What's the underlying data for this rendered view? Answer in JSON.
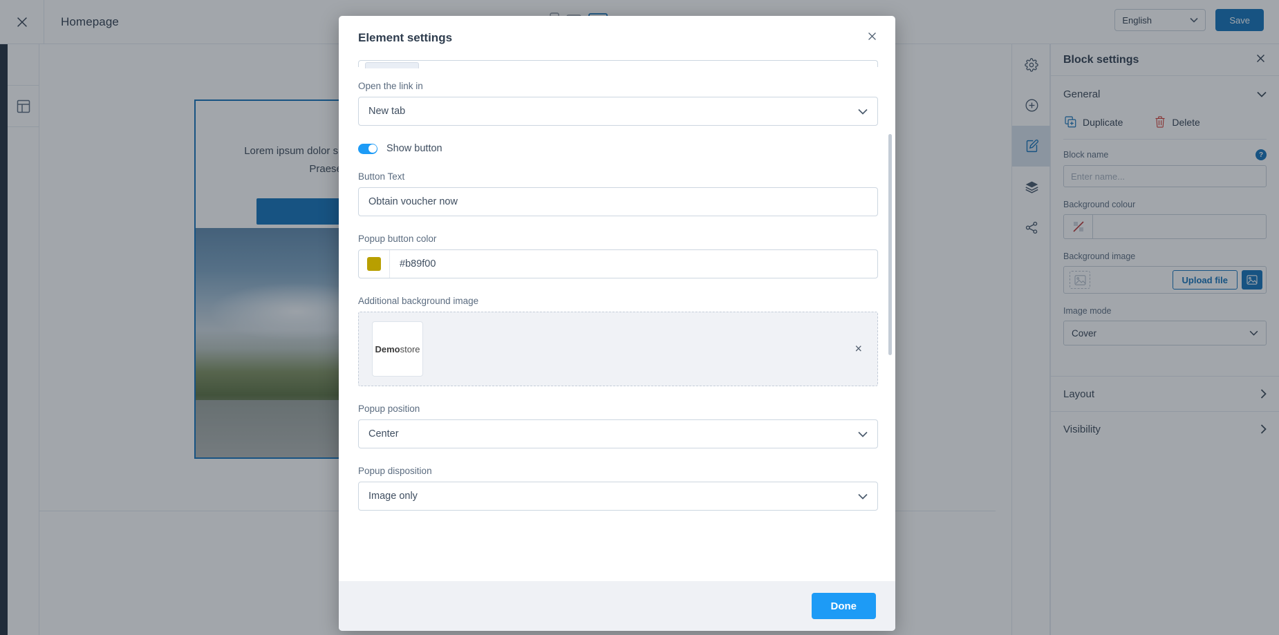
{
  "topbar": {
    "close_icon": "close-icon",
    "page_title": "Homepage",
    "devices": [
      {
        "name": "mobile",
        "active": false
      },
      {
        "name": "tablet",
        "active": false
      },
      {
        "name": "desktop",
        "active": true
      },
      {
        "name": "wide",
        "active": false
      }
    ],
    "language": "English",
    "save_label": "Save"
  },
  "left_tools": [
    {
      "icon": "layout-template-icon",
      "name": "template-tool"
    }
  ],
  "canvas": {
    "hero_text": "Lorem ipsum dolor sit amet, consectetur adipiscing elit ultricies vestibulum. Nulla facilisi. Praesent consectetur augue. Orci varius natoque penatibus",
    "cta_label": ""
  },
  "right_rail": [
    {
      "name": "gear-icon",
      "active": false
    },
    {
      "name": "plus-circle-icon",
      "active": false
    },
    {
      "name": "edit-document-icon",
      "active": true
    },
    {
      "name": "layers-icon",
      "active": false
    },
    {
      "name": "share-icon",
      "active": false
    }
  ],
  "block_settings": {
    "title": "Block settings",
    "close_icon": "close-icon",
    "general_label": "General",
    "duplicate_label": "Duplicate",
    "delete_label": "Delete",
    "block_name_label": "Block name",
    "block_name_placeholder": "Enter name...",
    "help_glyph": "?",
    "background_colour_label": "Background colour",
    "background_colour_value": "",
    "background_image_label": "Background image",
    "upload_file_label": "Upload file",
    "image_mode_label": "Image mode",
    "image_mode_value": "Cover",
    "layout_label": "Layout",
    "visibility_label": "Visibility"
  },
  "modal": {
    "title": "Element settings",
    "close_icon": "close-icon",
    "open_link_label": "Open the link in",
    "open_link_value": "New tab",
    "show_button_label": "Show button",
    "show_button_on": true,
    "button_text_label": "Button Text",
    "button_text_value": "Obtain voucher now",
    "popup_button_color_label": "Popup button color",
    "popup_button_color_value": "#b89f00",
    "additional_bg_image_label": "Additional background image",
    "thumb_bold": "Demo",
    "thumb_light": "store",
    "remove_glyph": "×",
    "popup_position_label": "Popup position",
    "popup_position_value": "Center",
    "popup_disposition_label": "Popup disposition",
    "popup_disposition_value": "Image only",
    "done_label": "Done"
  },
  "colors": {
    "brand_blue": "#1070b8",
    "action_blue": "#1d9bf6",
    "popup_button": "#b89f00",
    "delete_red": "#d0342c"
  }
}
